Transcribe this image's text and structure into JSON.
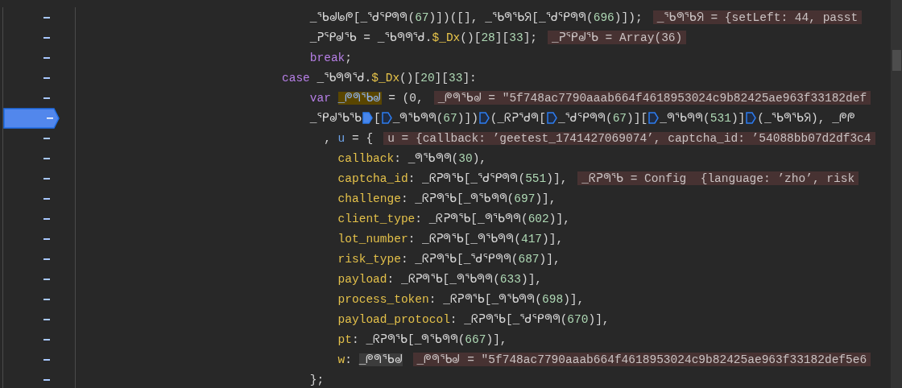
{
  "code": [
    {
      "children": [
        {
          "children": [
            {
              "breakpoint": false,
              "tokens": [
                {
                  "kind": "ident",
                  "text": "_ᖃᖙᖚᖘ"
                },
                {
                  "kind": "plain",
                  "text": "["
                },
                {
                  "kind": "ident",
                  "text": "_ᖁᕿᖗᖗ"
                },
                {
                  "kind": "plain",
                  "text": "("
                },
                {
                  "kind": "num",
                  "text": "67"
                },
                {
                  "kind": "plain",
                  "text": ")])([], "
                },
                {
                  "kind": "ident",
                  "text": "_ᖃᖗᖃᖆ"
                },
                {
                  "kind": "plain",
                  "text": "["
                },
                {
                  "kind": "ident",
                  "text": "_ᖁᕿᖗᖗ"
                },
                {
                  "kind": "plain",
                  "text": "("
                },
                {
                  "kind": "num",
                  "text": "696"
                },
                {
                  "kind": "plain",
                  "text": ")]);"
                },
                {
                  "kind": "value",
                  "text": "_ᖃᖗᖃᖆ = {setLeft: 44, passt"
                }
              ]
            },
            {
              "breakpoint": false,
              "tokens": [
                {
                  "kind": "ident",
                  "text": "_ᕈᕿᖙᖃ"
                },
                {
                  "kind": "plain",
                  "text": " = "
                },
                {
                  "kind": "ident",
                  "text": "_ᖃᖗᖗᖁ"
                },
                {
                  "kind": "plain",
                  "text": "."
                },
                {
                  "kind": "method",
                  "text": "$_Dx"
                },
                {
                  "kind": "plain",
                  "text": "()["
                },
                {
                  "kind": "num",
                  "text": "28"
                },
                {
                  "kind": "plain",
                  "text": "]["
                },
                {
                  "kind": "num",
                  "text": "33"
                },
                {
                  "kind": "plain",
                  "text": "];"
                },
                {
                  "kind": "value",
                  "text": "_ᕈᕿᖙᖃ = Array(36)"
                }
              ]
            },
            {
              "breakpoint": false,
              "tokens": [
                {
                  "kind": "kw",
                  "text": "break"
                },
                {
                  "kind": "plain",
                  "text": ";"
                }
              ]
            }
          ]
        }
      ]
    },
    {
      "breakpoint": false,
      "tokens": [
        {
          "kind": "kw",
          "text": "case "
        },
        {
          "kind": "ident",
          "text": "_ᖃᖗᖗᖁ"
        },
        {
          "kind": "plain",
          "text": "."
        },
        {
          "kind": "method",
          "text": "$_Dx"
        },
        {
          "kind": "plain",
          "text": "()["
        },
        {
          "kind": "num",
          "text": "20"
        },
        {
          "kind": "plain",
          "text": "]["
        },
        {
          "kind": "num",
          "text": "33"
        },
        {
          "kind": "plain",
          "text": "]:"
        }
      ],
      "children": [
        {
          "children": [
            {
              "breakpoint": false,
              "tokens": [
                {
                  "kind": "kw",
                  "text": "var "
                },
                {
                  "kind": "hl",
                  "text": "_ᖘᖗᖃᖙ"
                },
                {
                  "kind": "plain",
                  "text": " = (0,"
                },
                {
                  "kind": "value",
                  "text": "_ᖘᖗᖃᖙ = ″5f748ac7790aaab664f4618953024c9b82425ae963f33182def"
                }
              ]
            },
            {
              "breakpoint": true,
              "tokens": [
                {
                  "kind": "ident",
                  "text": "_ᕿᖙᖃᖃ"
                },
                {
                  "kind": "bp",
                  "active": true
                },
                {
                  "kind": "plain",
                  "text": "["
                },
                {
                  "kind": "bp",
                  "active": false
                },
                {
                  "kind": "ident",
                  "text": "_ᖗᖃᖗᖗ"
                },
                {
                  "kind": "plain",
                  "text": "("
                },
                {
                  "kind": "num",
                  "text": "67"
                },
                {
                  "kind": "plain",
                  "text": ")])"
                },
                {
                  "kind": "bp",
                  "active": false
                },
                {
                  "kind": "plain",
                  "text": "("
                },
                {
                  "kind": "ident",
                  "text": "_ᖇᕈᖁᖗ"
                },
                {
                  "kind": "plain",
                  "text": "["
                },
                {
                  "kind": "bp",
                  "active": false
                },
                {
                  "kind": "ident",
                  "text": "_ᖁᕿᖗᖗ"
                },
                {
                  "kind": "plain",
                  "text": "("
                },
                {
                  "kind": "num",
                  "text": "67"
                },
                {
                  "kind": "plain",
                  "text": ")]["
                },
                {
                  "kind": "bp",
                  "active": false
                },
                {
                  "kind": "ident",
                  "text": "_ᖗᖃᖗᖗ"
                },
                {
                  "kind": "plain",
                  "text": "("
                },
                {
                  "kind": "num",
                  "text": "531"
                },
                {
                  "kind": "plain",
                  "text": ")]"
                },
                {
                  "kind": "bp",
                  "active": false
                },
                {
                  "kind": "plain",
                  "text": "("
                },
                {
                  "kind": "ident",
                  "text": "_ᖃᖗᖃᖆ"
                },
                {
                  "kind": "plain",
                  "text": "), "
                },
                {
                  "kind": "ident",
                  "text": "_ᖘᖘ"
                }
              ],
              "children": [
                {
                  "breakpoint": false,
                  "tokens": [
                    {
                      "kind": "plain",
                      "text": ", "
                    },
                    {
                      "kind": "name",
                      "text": "u"
                    },
                    {
                      "kind": "plain",
                      "text": " = {"
                    },
                    {
                      "kind": "value",
                      "text": "u = {callback: ’geetest_1741427069074’, captcha_id: ’54088bb07d2df3c4"
                    }
                  ],
                  "children": [
                    {
                      "breakpoint": false,
                      "tokens": [
                        {
                          "kind": "prop",
                          "text": "callback"
                        },
                        {
                          "kind": "plain",
                          "text": ": "
                        },
                        {
                          "kind": "ident",
                          "text": "_ᖗᖃᖗᖗ"
                        },
                        {
                          "kind": "plain",
                          "text": "("
                        },
                        {
                          "kind": "num",
                          "text": "30"
                        },
                        {
                          "kind": "plain",
                          "text": "),"
                        }
                      ]
                    },
                    {
                      "breakpoint": false,
                      "tokens": [
                        {
                          "kind": "prop",
                          "text": "captcha_id"
                        },
                        {
                          "kind": "plain",
                          "text": ": "
                        },
                        {
                          "kind": "ident",
                          "text": "_ᖇᕈᖗᖃ"
                        },
                        {
                          "kind": "plain",
                          "text": "["
                        },
                        {
                          "kind": "ident",
                          "text": "_ᖁᕿᖗᖗ"
                        },
                        {
                          "kind": "plain",
                          "text": "("
                        },
                        {
                          "kind": "num",
                          "text": "551"
                        },
                        {
                          "kind": "plain",
                          "text": ")],"
                        },
                        {
                          "kind": "value",
                          "text": "_ᖇᕈᖗᖃ = Config  {language: ’zho’, risk"
                        }
                      ]
                    },
                    {
                      "breakpoint": false,
                      "tokens": [
                        {
                          "kind": "prop",
                          "text": "challenge"
                        },
                        {
                          "kind": "plain",
                          "text": ": "
                        },
                        {
                          "kind": "ident",
                          "text": "_ᖇᕈᖗᖃ"
                        },
                        {
                          "kind": "plain",
                          "text": "["
                        },
                        {
                          "kind": "ident",
                          "text": "_ᖗᖃᖗᖗ"
                        },
                        {
                          "kind": "plain",
                          "text": "("
                        },
                        {
                          "kind": "num",
                          "text": "697"
                        },
                        {
                          "kind": "plain",
                          "text": ")],"
                        }
                      ]
                    },
                    {
                      "breakpoint": false,
                      "tokens": [
                        {
                          "kind": "prop",
                          "text": "client_type"
                        },
                        {
                          "kind": "plain",
                          "text": ": "
                        },
                        {
                          "kind": "ident",
                          "text": "_ᖇᕈᖗᖃ"
                        },
                        {
                          "kind": "plain",
                          "text": "["
                        },
                        {
                          "kind": "ident",
                          "text": "_ᖗᖃᖗᖗ"
                        },
                        {
                          "kind": "plain",
                          "text": "("
                        },
                        {
                          "kind": "num",
                          "text": "602"
                        },
                        {
                          "kind": "plain",
                          "text": ")],"
                        }
                      ]
                    },
                    {
                      "breakpoint": false,
                      "tokens": [
                        {
                          "kind": "prop",
                          "text": "lot_number"
                        },
                        {
                          "kind": "plain",
                          "text": ": "
                        },
                        {
                          "kind": "ident",
                          "text": "_ᖇᕈᖗᖃ"
                        },
                        {
                          "kind": "plain",
                          "text": "["
                        },
                        {
                          "kind": "ident",
                          "text": "_ᖗᖃᖗᖗ"
                        },
                        {
                          "kind": "plain",
                          "text": "("
                        },
                        {
                          "kind": "num",
                          "text": "417"
                        },
                        {
                          "kind": "plain",
                          "text": ")],"
                        }
                      ]
                    },
                    {
                      "breakpoint": false,
                      "tokens": [
                        {
                          "kind": "prop",
                          "text": "risk_type"
                        },
                        {
                          "kind": "plain",
                          "text": ": "
                        },
                        {
                          "kind": "ident",
                          "text": "_ᖇᕈᖗᖃ"
                        },
                        {
                          "kind": "plain",
                          "text": "["
                        },
                        {
                          "kind": "ident",
                          "text": "_ᖁᕿᖗᖗ"
                        },
                        {
                          "kind": "plain",
                          "text": "("
                        },
                        {
                          "kind": "num",
                          "text": "687"
                        },
                        {
                          "kind": "plain",
                          "text": ")],"
                        }
                      ]
                    },
                    {
                      "breakpoint": false,
                      "tokens": [
                        {
                          "kind": "prop",
                          "text": "payload"
                        },
                        {
                          "kind": "plain",
                          "text": ": "
                        },
                        {
                          "kind": "ident",
                          "text": "_ᖇᕈᖗᖃ"
                        },
                        {
                          "kind": "plain",
                          "text": "["
                        },
                        {
                          "kind": "ident",
                          "text": "_ᖗᖃᖗᖗ"
                        },
                        {
                          "kind": "plain",
                          "text": "("
                        },
                        {
                          "kind": "num",
                          "text": "633"
                        },
                        {
                          "kind": "plain",
                          "text": ")],"
                        }
                      ]
                    },
                    {
                      "breakpoint": false,
                      "tokens": [
                        {
                          "kind": "prop",
                          "text": "process_token"
                        },
                        {
                          "kind": "plain",
                          "text": ": "
                        },
                        {
                          "kind": "ident",
                          "text": "_ᖇᕈᖗᖃ"
                        },
                        {
                          "kind": "plain",
                          "text": "["
                        },
                        {
                          "kind": "ident",
                          "text": "_ᖗᖃᖗᖗ"
                        },
                        {
                          "kind": "plain",
                          "text": "("
                        },
                        {
                          "kind": "num",
                          "text": "698"
                        },
                        {
                          "kind": "plain",
                          "text": ")],"
                        }
                      ]
                    },
                    {
                      "breakpoint": false,
                      "tokens": [
                        {
                          "kind": "prop",
                          "text": "payload_protocol"
                        },
                        {
                          "kind": "plain",
                          "text": ": "
                        },
                        {
                          "kind": "ident",
                          "text": "_ᖇᕈᖗᖃ"
                        },
                        {
                          "kind": "plain",
                          "text": "["
                        },
                        {
                          "kind": "ident",
                          "text": "_ᖁᕿᖗᖗ"
                        },
                        {
                          "kind": "plain",
                          "text": "("
                        },
                        {
                          "kind": "num",
                          "text": "670"
                        },
                        {
                          "kind": "plain",
                          "text": ")],"
                        }
                      ]
                    },
                    {
                      "breakpoint": false,
                      "tokens": [
                        {
                          "kind": "prop",
                          "text": "pt"
                        },
                        {
                          "kind": "plain",
                          "text": ": "
                        },
                        {
                          "kind": "ident",
                          "text": "_ᖇᕈᖗᖃ"
                        },
                        {
                          "kind": "plain",
                          "text": "["
                        },
                        {
                          "kind": "ident",
                          "text": "_ᖗᖃᖗᖗ"
                        },
                        {
                          "kind": "plain",
                          "text": "("
                        },
                        {
                          "kind": "num",
                          "text": "667"
                        },
                        {
                          "kind": "plain",
                          "text": ")],"
                        }
                      ]
                    },
                    {
                      "breakpoint": false,
                      "tokens": [
                        {
                          "kind": "prop",
                          "text": "w"
                        },
                        {
                          "kind": "plain",
                          "text": ": "
                        },
                        {
                          "kind": "ref",
                          "text": "_ᖘᖗᖃᖙ"
                        },
                        {
                          "kind": "value",
                          "text": "_ᖘᖗᖃᖙ = ″5f748ac7790aaab664f4618953024c9b82425ae963f33182def5e6"
                        }
                      ]
                    }
                  ]
                }
              ]
            },
            {
              "breakpoint": false,
              "tokens": [
                {
                  "kind": "plain",
                  "text": "};"
                }
              ]
            }
          ]
        }
      ]
    }
  ]
}
